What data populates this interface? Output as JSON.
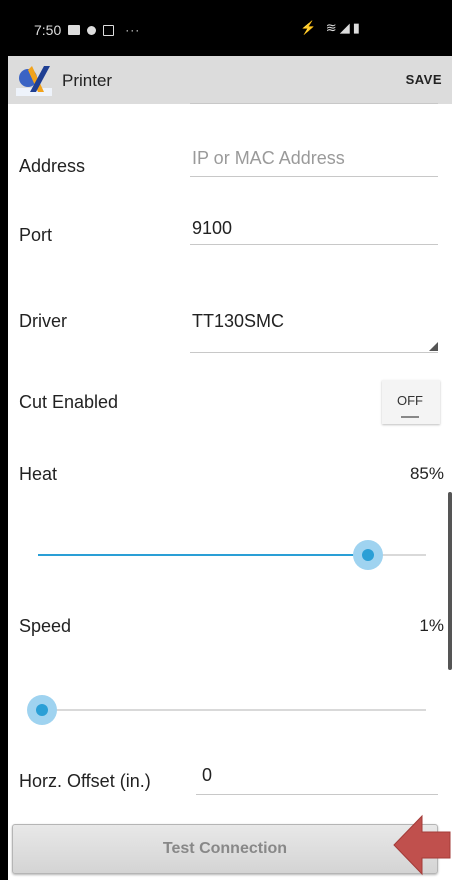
{
  "status_bar": {
    "time": "7:50",
    "more": "···",
    "right_icons": "⚡ ≋◢▮"
  },
  "toolbar": {
    "title": "Printer",
    "save_label": "SAVE"
  },
  "form": {
    "address": {
      "label": "Address",
      "placeholder": "IP or MAC Address",
      "value": ""
    },
    "port": {
      "label": "Port",
      "value": "9100"
    },
    "driver": {
      "label": "Driver",
      "value": "TT130SMC"
    },
    "cut_enabled": {
      "label": "Cut Enabled",
      "state": "OFF"
    },
    "heat": {
      "label": "Heat",
      "value_text": "85%",
      "value": 0.85
    },
    "speed": {
      "label": "Speed",
      "value_text": "1%",
      "value": 0.01
    },
    "horz_offset": {
      "label": "Horz. Offset (in.)",
      "value": "0"
    }
  },
  "test_button": {
    "label": "Test Connection"
  },
  "colors": {
    "accent": "#2a9fd6",
    "arrow": "#c0504d",
    "toolbar_bg": "#dcdcdc"
  },
  "icons": {
    "logo": "app-logo",
    "spinner": "dropdown-triangle-icon",
    "annotation": "red-arrow-pointer"
  }
}
